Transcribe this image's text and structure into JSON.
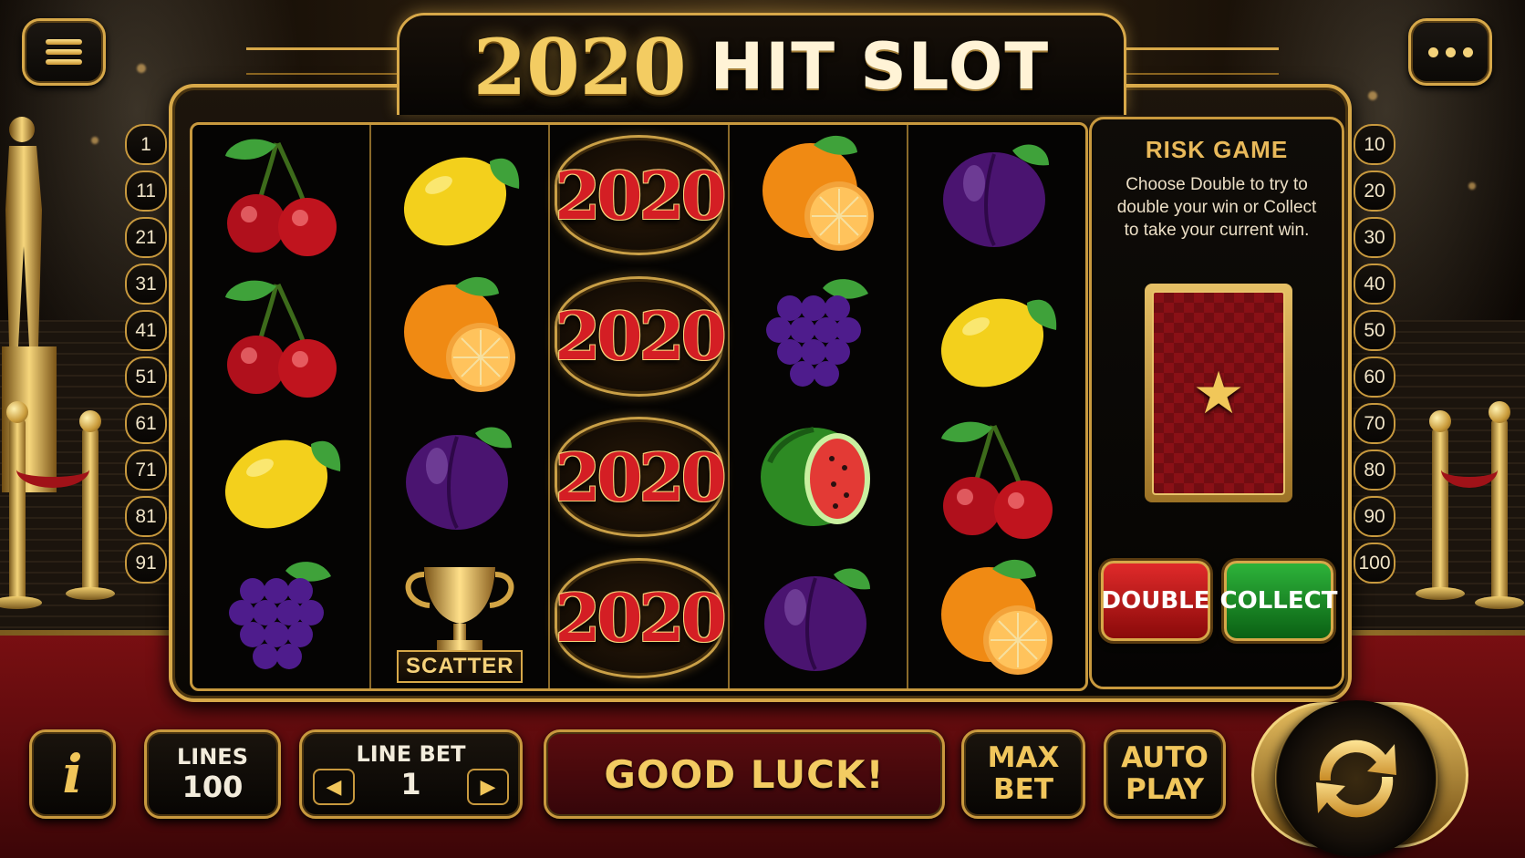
{
  "title": {
    "year": "2020",
    "name": "HIT SLOT"
  },
  "lines_left": [
    "1",
    "11",
    "21",
    "31",
    "41",
    "51",
    "61",
    "71",
    "81",
    "91"
  ],
  "lines_right": [
    "10",
    "20",
    "30",
    "40",
    "50",
    "60",
    "70",
    "80",
    "90",
    "100"
  ],
  "reels": [
    [
      "cherry",
      "cherry",
      "lemon",
      "grapes"
    ],
    [
      "lemon",
      "orange",
      "plum",
      "scatter"
    ],
    [
      "2020",
      "2020",
      "2020",
      "2020"
    ],
    [
      "orange",
      "grapes",
      "watermelon",
      "plum"
    ],
    [
      "plum",
      "lemon",
      "cherry",
      "orange"
    ]
  ],
  "symbol_2020_text": "2020",
  "scatter_label": "SCATTER",
  "risk": {
    "title": "RISK GAME",
    "text": "Choose Double to try to double your win or Collect to take your current win.",
    "double_label": "DOUBLE",
    "collect_label": "COLLECT"
  },
  "bottom": {
    "info_icon": "i",
    "lines_label": "LINES",
    "lines_value": "100",
    "linebet_label": "LINE BET",
    "linebet_value": "1",
    "message": "GOOD LUCK!",
    "maxbet_line1": "MAX",
    "maxbet_line2": "BET",
    "autoplay_line1": "AUTO",
    "autoplay_line2": "PLAY"
  },
  "icons": {
    "menu": "menu-icon",
    "more": "more-icon",
    "spin": "spin-icon",
    "left": "chevron-left-icon",
    "right": "chevron-right-icon"
  },
  "colors": {
    "gold": "#d7a849",
    "red_button": "#c0161c",
    "green_button": "#1e8c28",
    "carpet": "#6a0c0f"
  }
}
